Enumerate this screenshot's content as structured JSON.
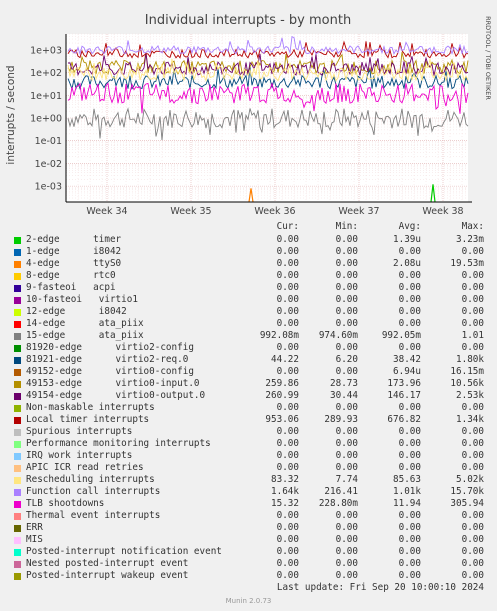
{
  "chart_data": {
    "type": "line",
    "title": "Individual interrupts - by month",
    "ylabel": "interrupts / second",
    "xlabel": "",
    "side_label": "RRDTOOL / TOBI OETIKER",
    "yscale": "log",
    "ylim": [
      0.0002,
      5000
    ],
    "y_ticks": [
      {
        "value": 1000,
        "label": "1e+03"
      },
      {
        "value": 100,
        "label": "1e+02"
      },
      {
        "value": 10,
        "label": "1e+01"
      },
      {
        "value": 1,
        "label": "1e+00"
      },
      {
        "value": 0.1,
        "label": "1e-01"
      },
      {
        "value": 0.01,
        "label": "1e-02"
      },
      {
        "value": 0.001,
        "label": "1e-03"
      }
    ],
    "x_ticks": [
      "Week 34",
      "Week 35",
      "Week 36",
      "Week 37",
      "Week 38"
    ],
    "grid": true,
    "columns": [
      "Cur:",
      "Min:",
      "Avg:",
      "Max:"
    ],
    "series": [
      {
        "name": "2-edge      timer",
        "color": "#00cc00",
        "values": [
          "0.00",
          "0.00",
          "1.39u",
          "3.23m"
        ],
        "level": 0
      },
      {
        "name": "1-edge      i8042",
        "color": "#0066b3",
        "values": [
          "0.00",
          "0.00",
          "0.00",
          "0.00"
        ],
        "level": 0
      },
      {
        "name": "4-edge      ttyS0",
        "color": "#ff8000",
        "values": [
          "0.00",
          "0.00",
          "2.08u",
          "19.53m"
        ],
        "level": 0
      },
      {
        "name": "8-edge      rtc0",
        "color": "#ffcc00",
        "values": [
          "0.00",
          "0.00",
          "0.00",
          "0.00"
        ],
        "level": 0
      },
      {
        "name": "9-fasteoi   acpi",
        "color": "#330099",
        "values": [
          "0.00",
          "0.00",
          "0.00",
          "0.00"
        ],
        "level": 0
      },
      {
        "name": "10-fasteoi   virtio1",
        "color": "#990099",
        "values": [
          "0.00",
          "0.00",
          "0.00",
          "0.00"
        ],
        "level": 0
      },
      {
        "name": "12-edge      i8042",
        "color": "#ccff00",
        "values": [
          "0.00",
          "0.00",
          "0.00",
          "0.00"
        ],
        "level": 0
      },
      {
        "name": "14-edge      ata_piix",
        "color": "#ff0000",
        "values": [
          "0.00",
          "0.00",
          "0.00",
          "0.00"
        ],
        "level": 0
      },
      {
        "name": "15-edge      ata_piix",
        "color": "#808080",
        "values": [
          "992.08m",
          "974.60m",
          "992.05m",
          "1.01"
        ],
        "level": 0.99
      },
      {
        "name": "81920-edge      virtio2-config",
        "color": "#008f00",
        "values": [
          "0.00",
          "0.00",
          "0.00",
          "0.00"
        ],
        "level": 0
      },
      {
        "name": "81921-edge      virtio2-req.0",
        "color": "#00487d",
        "values": [
          "44.22",
          "6.20",
          "38.42",
          "1.80k"
        ],
        "level": 38
      },
      {
        "name": "49152-edge      virtio0-config",
        "color": "#b35a00",
        "values": [
          "0.00",
          "0.00",
          "6.94u",
          "16.15m"
        ],
        "level": 0
      },
      {
        "name": "49153-edge      virtio0-input.0",
        "color": "#b38f00",
        "values": [
          "259.86",
          "28.73",
          "173.96",
          "10.56k"
        ],
        "level": 174
      },
      {
        "name": "49154-edge      virtio0-output.0",
        "color": "#6b006b",
        "values": [
          "260.99",
          "30.44",
          "146.17",
          "2.53k"
        ],
        "level": 146
      },
      {
        "name": "Non-maskable interrupts",
        "color": "#8fb300",
        "values": [
          "0.00",
          "0.00",
          "0.00",
          "0.00"
        ],
        "level": 0
      },
      {
        "name": "Local timer interrupts",
        "color": "#b30000",
        "values": [
          "953.06",
          "289.93",
          "676.82",
          "1.34k"
        ],
        "level": 677
      },
      {
        "name": "Spurious interrupts",
        "color": "#bebebe",
        "values": [
          "0.00",
          "0.00",
          "0.00",
          "0.00"
        ],
        "level": 0
      },
      {
        "name": "Performance monitoring interrupts",
        "color": "#80ff80",
        "values": [
          "0.00",
          "0.00",
          "0.00",
          "0.00"
        ],
        "level": 0
      },
      {
        "name": "IRQ work interrupts",
        "color": "#80c9ff",
        "values": [
          "0.00",
          "0.00",
          "0.00",
          "0.00"
        ],
        "level": 0
      },
      {
        "name": "APIC ICR read retries",
        "color": "#ffc080",
        "values": [
          "0.00",
          "0.00",
          "0.00",
          "0.00"
        ],
        "level": 0
      },
      {
        "name": "Rescheduling interrupts",
        "color": "#ffe680",
        "values": [
          "83.32",
          "7.74",
          "85.63",
          "5.02k"
        ],
        "level": 86
      },
      {
        "name": "Function call interrupts",
        "color": "#aa80ff",
        "values": [
          "1.64k",
          "216.41",
          "1.01k",
          "15.70k"
        ],
        "level": 1010
      },
      {
        "name": "TLB shootdowns",
        "color": "#ee00cc",
        "values": [
          "15.32",
          "228.80m",
          "11.94",
          "305.94"
        ],
        "level": 12
      },
      {
        "name": "Thermal event interrupts",
        "color": "#ff8080",
        "values": [
          "0.00",
          "0.00",
          "0.00",
          "0.00"
        ],
        "level": 0
      },
      {
        "name": "ERR",
        "color": "#666600",
        "values": [
          "0.00",
          "0.00",
          "0.00",
          "0.00"
        ],
        "level": 0
      },
      {
        "name": "MIS",
        "color": "#ffbfff",
        "values": [
          "0.00",
          "0.00",
          "0.00",
          "0.00"
        ],
        "level": 0
      },
      {
        "name": "Posted-interrupt notification event",
        "color": "#00ffcc",
        "values": [
          "0.00",
          "0.00",
          "0.00",
          "0.00"
        ],
        "level": 0
      },
      {
        "name": "Nested posted-interrupt event",
        "color": "#cc6699",
        "values": [
          "0.00",
          "0.00",
          "0.00",
          "0.00"
        ],
        "level": 0
      },
      {
        "name": "Posted-interrupt wakeup event",
        "color": "#999900",
        "values": [
          "0.00",
          "0.00",
          "0.00",
          "0.00"
        ],
        "level": 0
      }
    ],
    "spikes": [
      {
        "series": "4-edge      ttyS0",
        "week_position": "Week 36",
        "value": 0.0008
      },
      {
        "series": "2-edge      timer",
        "week_position": "Week 38",
        "value": 0.0012
      }
    ]
  },
  "footer": {
    "last_update": "Last update: Fri Sep 20 10:00:10 2024",
    "munin": "Munin 2.0.73"
  }
}
